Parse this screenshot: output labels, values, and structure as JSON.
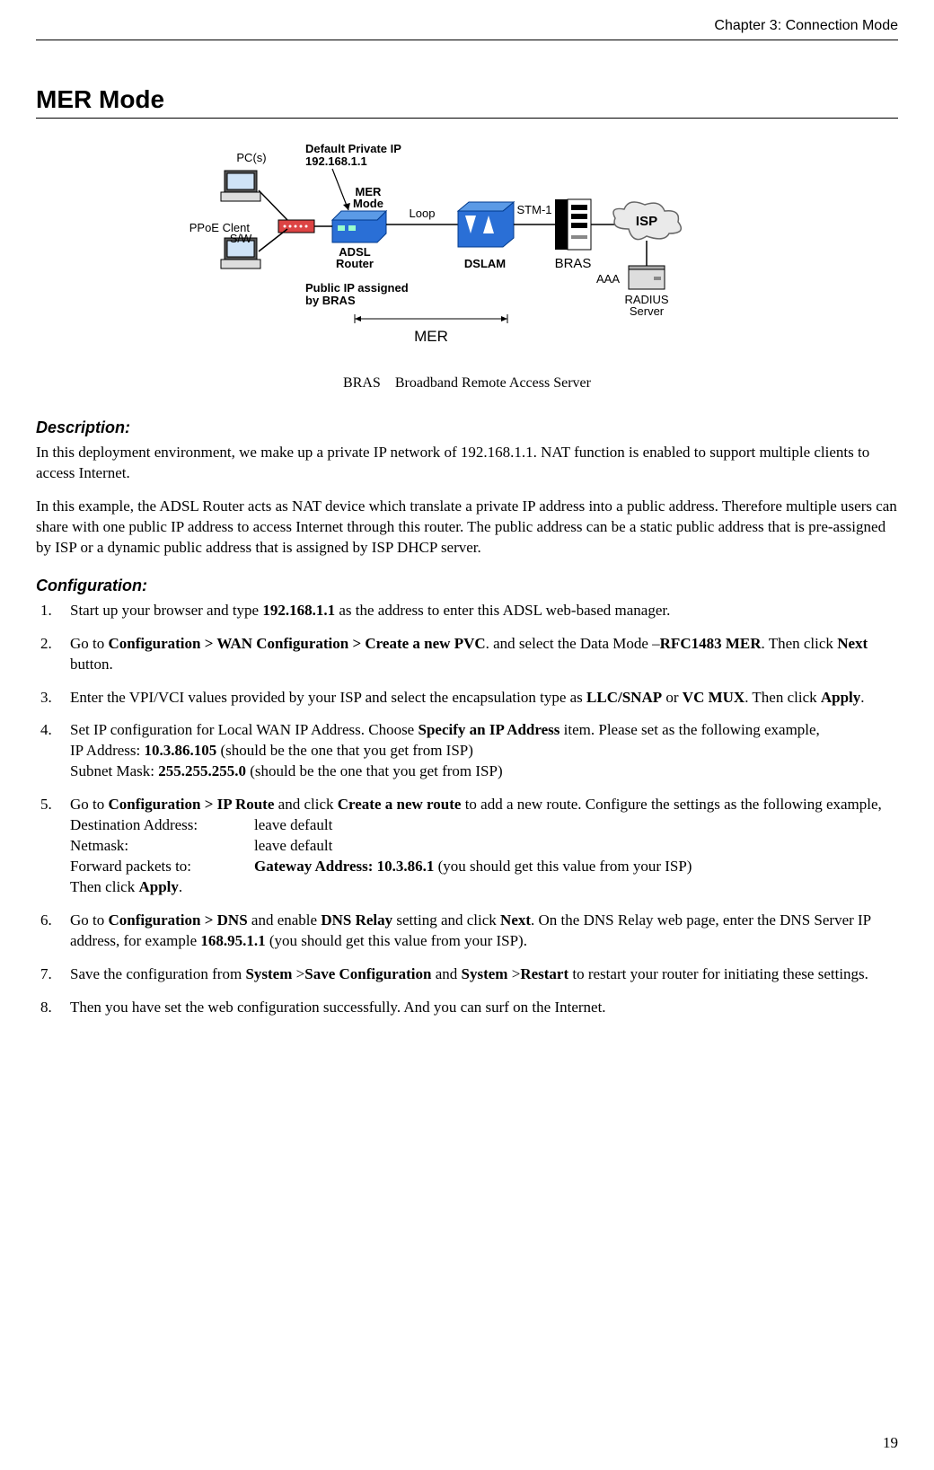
{
  "header": {
    "chapter": "Chapter 3: Connection Mode"
  },
  "title": "MER Mode",
  "diagram": {
    "labels": {
      "pcs": "PC(s)",
      "default_ip_1": "Default Private IP",
      "default_ip_2": "192.168.1.1",
      "mer_mode": "MER",
      "mer_mode_2": "Mode",
      "pppoe_1": "PPPoE Clent",
      "pppoe_2": "S/W",
      "adsl_1": "ADSL",
      "adsl_2": "Router",
      "loop": "Loop",
      "dslam": "DSLAM",
      "stm1": "STM-1",
      "bras": "BRAS",
      "isp": "ISP",
      "aaa": "AAA",
      "radius_1": "RADIUS",
      "radius_2": "Server",
      "public_ip_1": "Public IP assigned",
      "public_ip_2": "by BRAS",
      "mer": "MER"
    },
    "caption_abbr": "BRAS",
    "caption_text": "Broadband Remote Access Server"
  },
  "description": {
    "heading": "Description:",
    "p1": "In this deployment environment, we make up a private IP network of 192.168.1.1. NAT function is enabled to support multiple clients to access Internet.",
    "p2": "In this example, the ADSL Router acts as NAT device which translate a private IP address into a public address. Therefore multiple users can share with one public IP address to access Internet through this router. The public address can be a static public address that is pre-assigned by ISP or a dynamic public address that is assigned by ISP DHCP server."
  },
  "configuration": {
    "heading": "Configuration:",
    "step1_a": "Start up your browser and type ",
    "step1_b": "192.168.1.1",
    "step1_c": " as the address to enter this ADSL web-based manager.",
    "step2_a": "Go to ",
    "step2_b": "Configuration > WAN Configuration > Create a new PVC",
    "step2_c": ". and select the Data Mode –",
    "step2_d": "RFC1483 MER",
    "step2_e": ". Then click ",
    "step2_f": "Next",
    "step2_g": " button.",
    "step3_a": "Enter the VPI/VCI values provided by your ISP and select the encapsulation type as ",
    "step3_b": "LLC/SNAP",
    "step3_c": " or ",
    "step3_d": "VC MUX",
    "step3_e": ". Then click ",
    "step3_f": "Apply",
    "step3_g": ".",
    "step4_a": "Set IP configuration for Local WAN IP Address. Choose ",
    "step4_b": "Specify an IP Address",
    "step4_c": " item. Please set as the following example,",
    "step4_ip_a": "IP Address: ",
    "step4_ip_b": "10.3.86.105",
    "step4_ip_c": " (should be the one that you get from ISP)",
    "step4_sm_a": "Subnet Mask: ",
    "step4_sm_b": "255.255.255.0",
    "step4_sm_c": " (should be the one that you get from ISP)",
    "step5_a": "Go to ",
    "step5_b": "Configuration > IP Route",
    "step5_c": " and click ",
    "step5_d": "Create a new route",
    "step5_e": " to add a new route. Configure the settings as the following example,",
    "step5_dest_label": "Destination Address:",
    "step5_dest_val": "leave default",
    "step5_nm_label": "Netmask:",
    "step5_nm_val": "leave default",
    "step5_fwd_label": "Forward packets to:",
    "step5_fwd_val_b": "Gateway Address: 10.3.86.1",
    "step5_fwd_val_c": " (you should get this value from your ISP)",
    "step5_then_a": "Then click ",
    "step5_then_b": "Apply",
    "step5_then_c": ".",
    "step6_a": "Go to ",
    "step6_b": "Configuration > DNS",
    "step6_c": " and enable ",
    "step6_d": "DNS Relay",
    "step6_e": " setting and click ",
    "step6_f": "Next",
    "step6_g": ". On the DNS Relay web page, enter the DNS Server IP address, for example ",
    "step6_h": "168.95.1.1",
    "step6_i": " (you should get this value from your ISP).",
    "step7_a": "Save the configuration from ",
    "step7_b": "System",
    "step7_c": " >",
    "step7_d": "Save Configuration",
    "step7_e": " and ",
    "step7_f": "System",
    "step7_g": " >",
    "step7_h": "Restart",
    "step7_i": " to restart your router for initiating these settings.",
    "step8": "Then you have set the web configuration successfully. And you can surf on the Internet."
  },
  "page_number": "19"
}
